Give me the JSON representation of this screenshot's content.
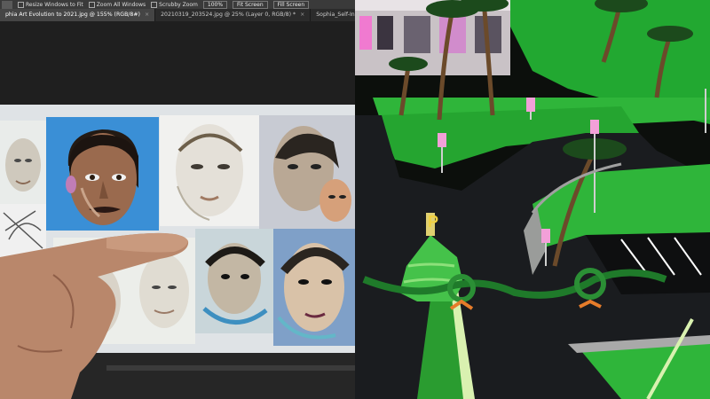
{
  "photoshop": {
    "options_bar": {
      "resize_windows": "Resize Windows to Fit",
      "zoom_all": "Zoom All Windows",
      "scrubby_zoom": "Scrubby Zoom",
      "zoom_value": "100%",
      "fit_screen": "Fit Screen",
      "fill_screen": "Fill Screen"
    },
    "tabs": [
      {
        "label": "phia Art Evolution to 2021.jpg @ 155% (RGB/8#)",
        "close": "×"
      },
      {
        "label": "20210319_203524.jpg @ 25% (Layer 0, RGB/8) *",
        "close": "×"
      },
      {
        "label": "Sophia_Self-Instantiatio-n_New",
        "close": ""
      }
    ]
  },
  "game": {
    "parking_sign": "P"
  },
  "colors": {
    "grass": "#2fb53a",
    "road": "#1a1c1f",
    "canvas_bg": "#dfe3e6",
    "portrait_blue": "#3a8fd6"
  }
}
